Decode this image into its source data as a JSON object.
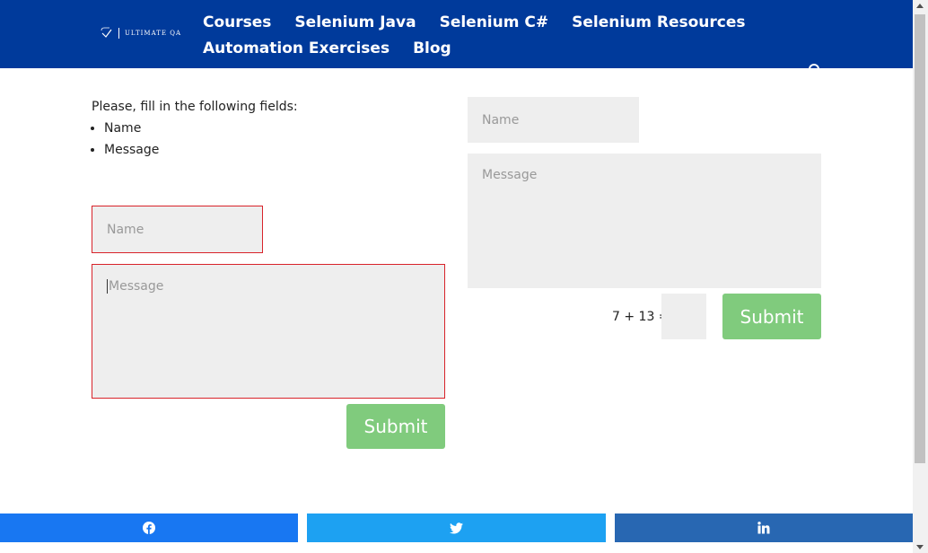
{
  "header": {
    "logo_text": "ULTIMATE QA",
    "nav_row1": [
      "Courses",
      "Selenium Java",
      "Selenium C#",
      "Selenium Resources"
    ],
    "nav_row2": [
      "Automation Exercises",
      "Blog"
    ],
    "background": "#003a9b"
  },
  "instructions": {
    "intro": "Please, fill in the following fields:",
    "items": [
      "Name",
      "Message"
    ]
  },
  "form_left": {
    "name_placeholder": "Name",
    "message_placeholder": "Message",
    "submit_label": "Submit",
    "error_border_color": "#d8232a"
  },
  "form_right": {
    "name_placeholder": "Name",
    "message_placeholder": "Message",
    "captcha_question": "7 + 13 =",
    "captcha_value": "",
    "submit_label": "Submit"
  },
  "share": [
    {
      "icon": "facebook-icon",
      "color": "#1877f2"
    },
    {
      "icon": "twitter-icon",
      "color": "#1da1f2"
    },
    {
      "icon": "linkedin-icon",
      "color": "#2867b2"
    }
  ],
  "colors": {
    "submit_button": "#80cb7d",
    "field_background": "#eeeeee"
  }
}
